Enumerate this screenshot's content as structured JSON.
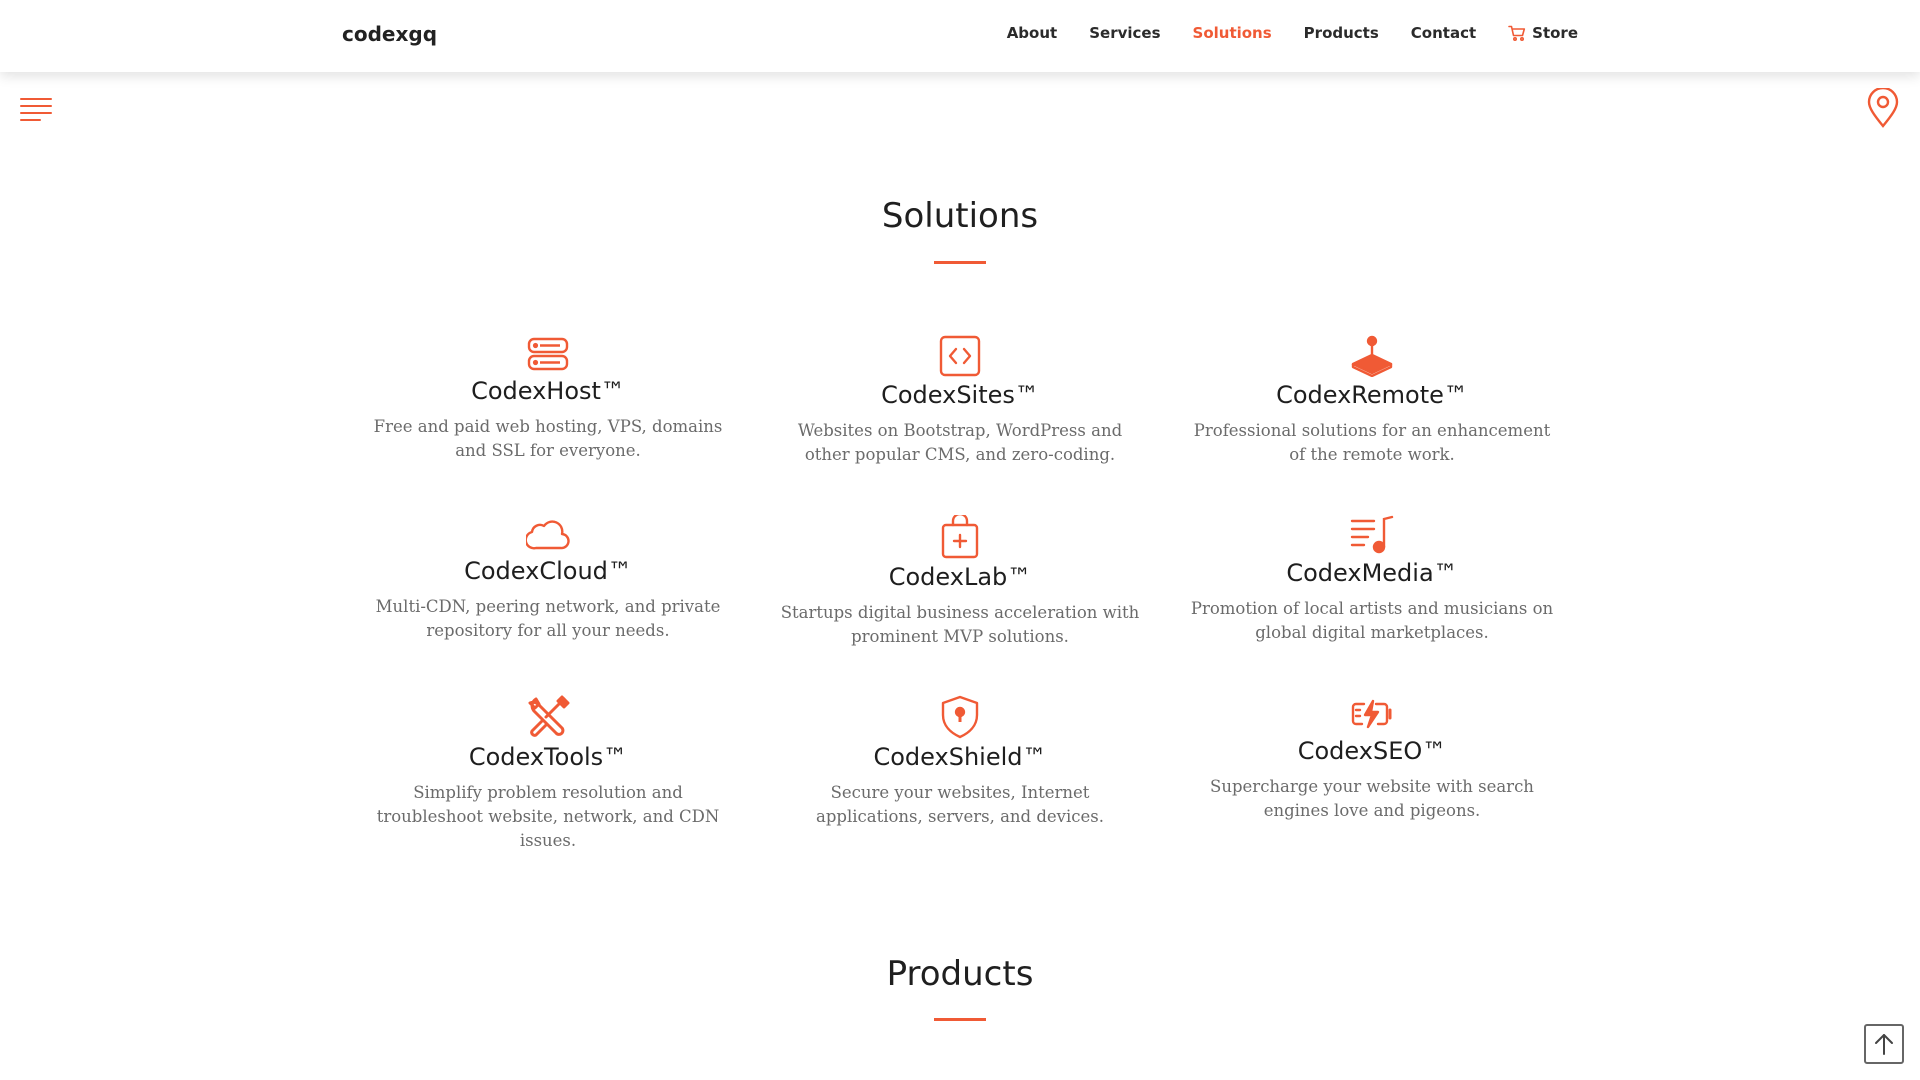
{
  "navbar": {
    "brand": "codexgq",
    "links": [
      {
        "label": "About"
      },
      {
        "label": "Services"
      },
      {
        "label": "Solutions"
      },
      {
        "label": "Products"
      },
      {
        "label": "Contact"
      },
      {
        "label": "Store",
        "icon": "cart-icon"
      }
    ],
    "active": "Solutions"
  },
  "side_controls": {
    "menu_icon": "menu-lines-icon",
    "location_icon": "location-pin-icon"
  },
  "solutions": {
    "title": "Solutions",
    "items": [
      {
        "icon": "server-icon",
        "title": "CodexHost™",
        "description": "Free and paid web hosting, VPS, domains and SSL for everyone."
      },
      {
        "icon": "code-window-icon",
        "title": "CodexSites™",
        "description": "Websites on Bootstrap, WordPress and other popular CMS, and zero-coding."
      },
      {
        "icon": "joystick-icon",
        "title": "CodexRemote™",
        "description": "Professional solutions for an enhancement of the remote work."
      },
      {
        "icon": "cloud-icon",
        "title": "CodexCloud™",
        "description": "Multi-CDN, peering network, and private repository for all your needs."
      },
      {
        "icon": "medical-bag-icon",
        "title": "CodexLab™",
        "description": "Startups digital business acceleration with prominent MVP solutions."
      },
      {
        "icon": "music-playlist-icon",
        "title": "CodexMedia™",
        "description": "Promotion of local artists and musicians on global digital marketplaces."
      },
      {
        "icon": "tools-icon",
        "title": "CodexTools™",
        "description": "Simplify problem resolution and troubleshoot website, network, and CDN issues."
      },
      {
        "icon": "shield-icon",
        "title": "CodexShield™",
        "description": "Secure your websites, Internet applications, servers, and devices."
      },
      {
        "icon": "battery-charge-icon",
        "title": "CodexSEO™",
        "description": "Supercharge your website with search engines love and pigeons."
      }
    ]
  },
  "products": {
    "title": "Products"
  },
  "back_to_top_icon": "arrow-up-icon",
  "colors": {
    "accent": "#f05a35",
    "text": "#1e1e1e",
    "muted": "#6b6b6b"
  }
}
